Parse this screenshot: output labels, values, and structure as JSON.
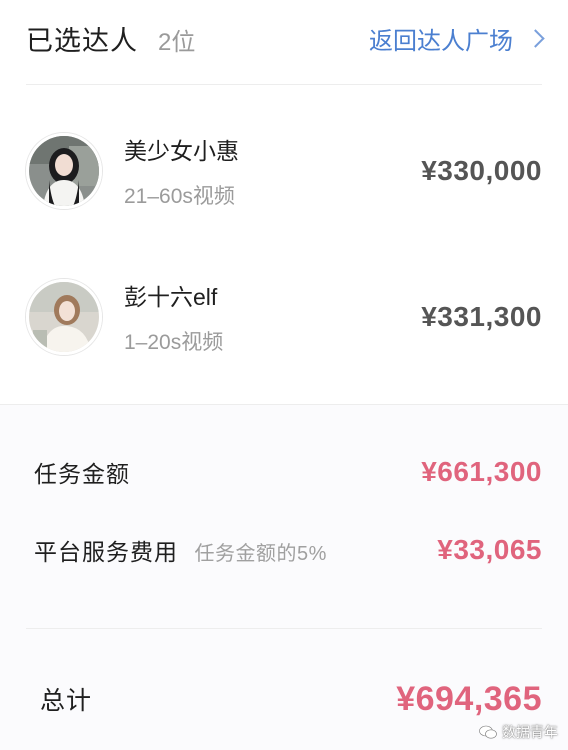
{
  "header": {
    "title": "已选达人",
    "count": "2位",
    "back_label": "返回达人广场"
  },
  "creators": [
    {
      "name": "美少女小惠",
      "type": "21–60s视频",
      "price": "¥330,000"
    },
    {
      "name": "彭十六elf",
      "type": "1–20s视频",
      "price": "¥331,300"
    }
  ],
  "summary": {
    "task_label": "任务金额",
    "task_amount": "¥661,300",
    "fee_label": "平台服务费用",
    "fee_note": "任务金额的5%",
    "fee_amount": "¥33,065",
    "total_label": "总计",
    "total_amount": "¥694,365"
  },
  "watermark": {
    "text": "数据青年"
  },
  "colors": {
    "accent_blue": "#4b7fd0",
    "amount_pink": "#e0647d"
  }
}
